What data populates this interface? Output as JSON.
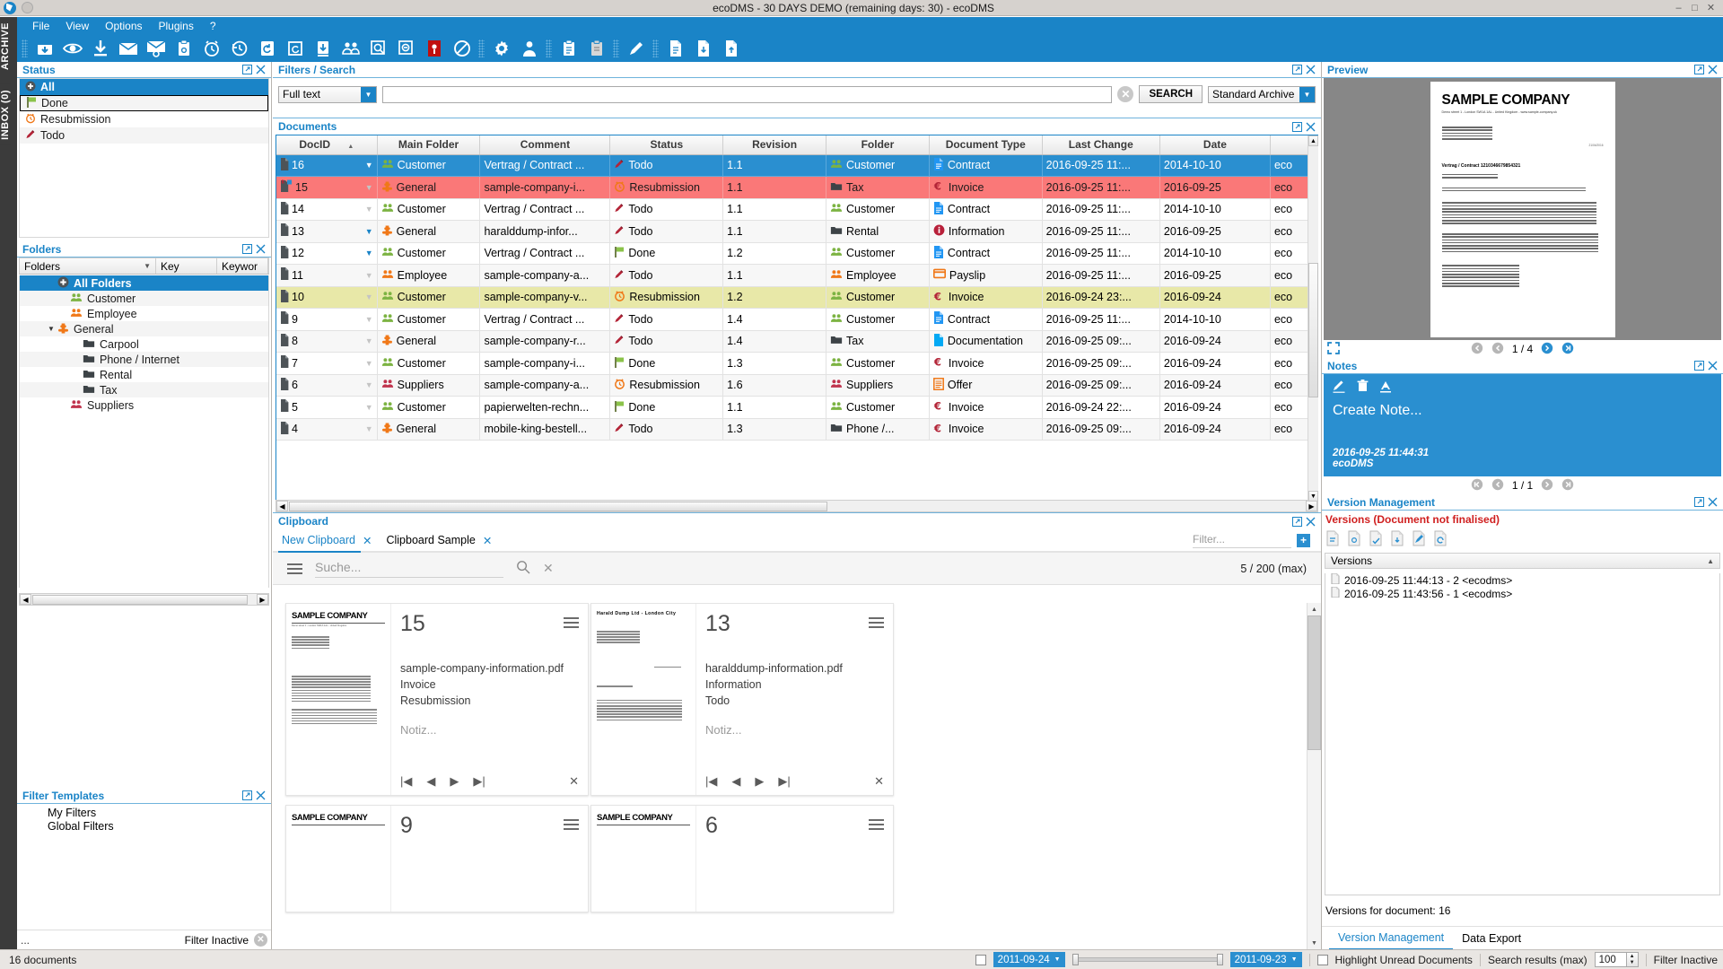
{
  "window": {
    "title": "ecoDMS - 30 DAYS DEMO (remaining days: 30) - ecoDMS",
    "min_label": "–",
    "max_label": "□",
    "close_label": "✕"
  },
  "menu": {
    "items": [
      "File",
      "View",
      "Options",
      "Plugins",
      "?"
    ]
  },
  "rail": {
    "archive_label": "ARCHIVE",
    "inbox_label": "INBOX (0)"
  },
  "toolbar": {
    "icons": [
      "archive-inbox-icon",
      "eye-preview-icon",
      "download-icon",
      "email-icon",
      "email-link-icon",
      "clipboard-link-icon",
      "alarm-clock-icon",
      "history-back-icon",
      "restore-icon",
      "refresh-doc-icon",
      "archive-down-icon",
      "users-icon",
      "zoom-in-icon",
      "zoom-out-icon",
      "pdf-red-icon",
      "no-entry-icon",
      "settings-gear-icon",
      "user-profile-icon",
      "clipboard-list-icon",
      "clipboard-doc-icon",
      "edit-pencil-icon",
      "document-new-icon",
      "document-export-icon",
      "document-import-icon"
    ]
  },
  "status_panel": {
    "title": "Status",
    "items": [
      {
        "label": "All",
        "icon": "plus-circle-icon",
        "selected": true
      },
      {
        "label": "Done",
        "icon": "green-flag-icon",
        "selected": false
      },
      {
        "label": "Resubmission",
        "icon": "orange-alarm-icon",
        "selected": false
      },
      {
        "label": "Todo",
        "icon": "red-pencil-icon",
        "selected": false
      }
    ]
  },
  "folders_panel": {
    "title": "Folders",
    "columns": [
      "Folders",
      "Key",
      "Keywor"
    ],
    "items": [
      {
        "label": "All Folders",
        "icon": "plus-circle-icon",
        "indent": 0,
        "selected": true,
        "twisty": ""
      },
      {
        "label": "Customer",
        "icon": "green-people-icon",
        "indent": 1,
        "selected": false,
        "twisty": ""
      },
      {
        "label": "Employee",
        "icon": "orange-people-icon",
        "indent": 1,
        "selected": false,
        "twisty": ""
      },
      {
        "label": "General",
        "icon": "orange-puzzle-icon",
        "indent": 1,
        "selected": false,
        "twisty": "▼"
      },
      {
        "label": "Carpool",
        "icon": "dark-folder-icon",
        "indent": 2,
        "selected": false,
        "twisty": ""
      },
      {
        "label": "Phone / Internet",
        "icon": "dark-folder-icon",
        "indent": 2,
        "selected": false,
        "twisty": ""
      },
      {
        "label": "Rental",
        "icon": "dark-folder-icon",
        "indent": 2,
        "selected": false,
        "twisty": ""
      },
      {
        "label": "Tax",
        "icon": "dark-folder-icon",
        "indent": 2,
        "selected": false,
        "twisty": ""
      },
      {
        "label": "Suppliers",
        "icon": "red-people-icon",
        "indent": 1,
        "selected": false,
        "twisty": ""
      }
    ]
  },
  "filter_templates_panel": {
    "title": "Filter Templates",
    "items": [
      "My Filters",
      "Global Filters"
    ],
    "footer_dots": "...",
    "footer_label": "Filter Inactive"
  },
  "filters_search": {
    "title": "Filters / Search",
    "mode_value": "Full text",
    "query_value": "",
    "query_placeholder": "",
    "search_button": "SEARCH",
    "archive_value": "Standard Archive"
  },
  "documents": {
    "title": "Documents",
    "columns": [
      "DocID",
      "Main Folder",
      "Comment",
      "Status",
      "Revision",
      "Folder",
      "Document Type",
      "Last Change",
      "Date",
      ""
    ],
    "sort_column": "DocID",
    "sort_dir": "asc",
    "rows": [
      {
        "docid": "16",
        "main_folder": "Customer",
        "mf_icon": "green-people-icon",
        "comment": "Vertrag / Contract ...",
        "status": "Todo",
        "status_icon": "red-pencil-icon",
        "revision": "1.1",
        "folder": "Customer",
        "folder_icon": "green-people-icon",
        "doctype": "Contract",
        "doctype_icon": "blue-contract-icon",
        "last_change": "2016-09-25 11:...",
        "date": "2014-10-10",
        "owner": "eco",
        "row_style": "r-sel",
        "caret": "full"
      },
      {
        "docid": "15",
        "main_folder": "General",
        "mf_icon": "orange-puzzle-icon",
        "comment": "sample-company-i...",
        "status": "Resubmission",
        "status_icon": "orange-alarm-icon",
        "revision": "1.1",
        "folder": "Tax",
        "folder_icon": "dark-folder-icon",
        "doctype": "Invoice",
        "doctype_icon": "euro-invoice-icon",
        "last_change": "2016-09-25 11:...",
        "date": "2016-09-25",
        "owner": "eco",
        "row_style": "r-red",
        "caret": "dim"
      },
      {
        "docid": "14",
        "main_folder": "Customer",
        "mf_icon": "green-people-icon",
        "comment": "Vertrag / Contract ...",
        "status": "Todo",
        "status_icon": "red-pencil-icon",
        "revision": "1.1",
        "folder": "Customer",
        "folder_icon": "green-people-icon",
        "doctype": "Contract",
        "doctype_icon": "blue-contract-icon",
        "last_change": "2016-09-25 11:...",
        "date": "2014-10-10",
        "owner": "eco",
        "row_style": "r-white",
        "caret": "dim"
      },
      {
        "docid": "13",
        "main_folder": "General",
        "mf_icon": "orange-puzzle-icon",
        "comment": "haralddump-infor...",
        "status": "Todo",
        "status_icon": "red-pencil-icon",
        "revision": "1.1",
        "folder": "Rental",
        "folder_icon": "dark-folder-icon",
        "doctype": "Information",
        "doctype_icon": "red-info-icon",
        "last_change": "2016-09-25 11:...",
        "date": "2016-09-25",
        "owner": "eco",
        "row_style": "r-alt",
        "caret": "full"
      },
      {
        "docid": "12",
        "main_folder": "Customer",
        "mf_icon": "green-people-icon",
        "comment": "Vertrag / Contract ...",
        "status": "Done",
        "status_icon": "green-flag-icon",
        "revision": "1.2",
        "folder": "Customer",
        "folder_icon": "green-people-icon",
        "doctype": "Contract",
        "doctype_icon": "blue-contract-icon",
        "last_change": "2016-09-25 11:...",
        "date": "2014-10-10",
        "owner": "eco",
        "row_style": "r-white",
        "caret": "full"
      },
      {
        "docid": "11",
        "main_folder": "Employee",
        "mf_icon": "orange-people-icon",
        "comment": "sample-company-a...",
        "status": "Todo",
        "status_icon": "red-pencil-icon",
        "revision": "1.1",
        "folder": "Employee",
        "folder_icon": "orange-people-icon",
        "doctype": "Payslip",
        "doctype_icon": "orange-payslip-icon",
        "last_change": "2016-09-25 11:...",
        "date": "2016-09-25",
        "owner": "eco",
        "row_style": "r-alt",
        "caret": "dim"
      },
      {
        "docid": "10",
        "main_folder": "Customer",
        "mf_icon": "green-people-icon",
        "comment": "sample-company-v...",
        "status": "Resubmission",
        "status_icon": "orange-alarm-icon",
        "revision": "1.2",
        "folder": "Customer",
        "folder_icon": "green-people-icon",
        "doctype": "Invoice",
        "doctype_icon": "euro-invoice-icon",
        "last_change": "2016-09-24 23:...",
        "date": "2016-09-24",
        "owner": "eco",
        "row_style": "r-yellow",
        "caret": "dim"
      },
      {
        "docid": "9",
        "main_folder": "Customer",
        "mf_icon": "green-people-icon",
        "comment": "Vertrag / Contract ...",
        "status": "Todo",
        "status_icon": "red-pencil-icon",
        "revision": "1.4",
        "folder": "Customer",
        "folder_icon": "green-people-icon",
        "doctype": "Contract",
        "doctype_icon": "blue-contract-icon",
        "last_change": "2016-09-25 11:...",
        "date": "2014-10-10",
        "owner": "eco",
        "row_style": "r-white",
        "caret": "dim"
      },
      {
        "docid": "8",
        "main_folder": "General",
        "mf_icon": "orange-puzzle-icon",
        "comment": "sample-company-r...",
        "status": "Todo",
        "status_icon": "red-pencil-icon",
        "revision": "1.4",
        "folder": "Tax",
        "folder_icon": "dark-folder-icon",
        "doctype": "Documentation",
        "doctype_icon": "blue-doc-icon",
        "last_change": "2016-09-25 09:...",
        "date": "2016-09-24",
        "owner": "eco",
        "row_style": "r-alt",
        "caret": "dim"
      },
      {
        "docid": "7",
        "main_folder": "Customer",
        "mf_icon": "green-people-icon",
        "comment": "sample-company-i...",
        "status": "Done",
        "status_icon": "green-flag-icon",
        "revision": "1.3",
        "folder": "Customer",
        "folder_icon": "green-people-icon",
        "doctype": "Invoice",
        "doctype_icon": "euro-invoice-icon",
        "last_change": "2016-09-25 09:...",
        "date": "2016-09-24",
        "owner": "eco",
        "row_style": "r-white",
        "caret": "dim"
      },
      {
        "docid": "6",
        "main_folder": "Suppliers",
        "mf_icon": "red-people-icon",
        "comment": "sample-company-a...",
        "status": "Resubmission",
        "status_icon": "orange-alarm-icon",
        "revision": "1.6",
        "folder": "Suppliers",
        "folder_icon": "red-people-icon",
        "doctype": "Offer",
        "doctype_icon": "orange-offer-icon",
        "last_change": "2016-09-25 09:...",
        "date": "2016-09-24",
        "owner": "eco",
        "row_style": "r-alt",
        "caret": "dim"
      },
      {
        "docid": "5",
        "main_folder": "Customer",
        "mf_icon": "green-people-icon",
        "comment": "papierwelten-rechn...",
        "status": "Done",
        "status_icon": "green-flag-icon",
        "revision": "1.1",
        "folder": "Customer",
        "folder_icon": "green-people-icon",
        "doctype": "Invoice",
        "doctype_icon": "euro-invoice-icon",
        "last_change": "2016-09-24 22:...",
        "date": "2016-09-24",
        "owner": "eco",
        "row_style": "r-white",
        "caret": "dim"
      },
      {
        "docid": "4",
        "main_folder": "General",
        "mf_icon": "orange-puzzle-icon",
        "comment": "mobile-king-bestell...",
        "status": "Todo",
        "status_icon": "red-pencil-icon",
        "revision": "1.3",
        "folder": "Phone /...",
        "folder_icon": "dark-folder-icon",
        "doctype": "Invoice",
        "doctype_icon": "euro-invoice-icon",
        "last_change": "2016-09-25 09:...",
        "date": "2016-09-24",
        "owner": "eco",
        "row_style": "r-alt",
        "caret": "dim"
      }
    ]
  },
  "clipboard": {
    "title": "Clipboard",
    "tabs": [
      {
        "label": "New Clipboard",
        "active": true,
        "close": "✕"
      },
      {
        "label": "Clipboard Sample",
        "active": false,
        "close": "✕"
      }
    ],
    "search_placeholder": "Suche...",
    "count_label": "5 / 200 (max)",
    "filter_placeholder": "Filter...",
    "add_label": "+",
    "cards": [
      {
        "num": "15",
        "file": "sample-company-information.pdf",
        "type": "Invoice",
        "status": "Resubmission",
        "note": "Notiz...",
        "thumb_title": "SAMPLE COMPANY"
      },
      {
        "num": "13",
        "file": "haralddump-information.pdf",
        "type": "Information",
        "status": "Todo",
        "note": "Notiz...",
        "thumb_title": "Harald Dump Ltd - London City"
      },
      {
        "num": "9",
        "file": "",
        "type": "",
        "status": "",
        "note": "",
        "thumb_title": "SAMPLE COMPANY"
      },
      {
        "num": "6",
        "file": "",
        "type": "",
        "status": "",
        "note": "",
        "thumb_title": "SAMPLE COMPANY"
      }
    ]
  },
  "preview": {
    "title": "Preview",
    "doc_title": "SAMPLE COMPANY",
    "doc_sub": "Demo street 1 - London SW1A 1AL - United Kingdom - www.sample-company.uk",
    "doc_heading": "Vertrag / Contract 1210346679854321",
    "page_indicator": "1 / 4",
    "fullscreen_icon": "fullscreen-icon"
  },
  "notes": {
    "title": "Notes",
    "placeholder": "Create Note...",
    "stamp_time": "2016-09-25 11:44:31",
    "stamp_user": "ecoDMS",
    "page_indicator": "1 / 1",
    "tools": [
      "edit-pencil-icon",
      "trash-icon",
      "font-color-icon"
    ]
  },
  "version_management": {
    "title": "Version Management",
    "warning": "Versions (Document not finalised)",
    "list_header": "Versions",
    "versions": [
      {
        "label": "2016-09-25 11:44:13 - 2 <ecodms>",
        "selected": false
      },
      {
        "label": "2016-09-25 11:43:56 - 1 <ecodms>",
        "selected": false
      }
    ],
    "versions_for": "Versions for document: 16",
    "tabs": [
      {
        "label": "Version Management",
        "active": true
      },
      {
        "label": "Data Export",
        "active": false
      }
    ]
  },
  "statusbar": {
    "doc_count": "16 documents",
    "date_from": "2011-09-24",
    "date_to": "2011-09-23",
    "highlight_label": "Highlight Unread Documents",
    "results_label": "Search results (max)",
    "results_value": "100",
    "filter_label": "Filter Inactive"
  },
  "colors": {
    "accent": "#1a84c7",
    "selection": "#2a8fd0",
    "red_row": "#fa7878",
    "yellow_row": "#e8e8a8",
    "warning_red": "#d01f1f",
    "green": "#7cb342",
    "orange": "#f07818"
  }
}
